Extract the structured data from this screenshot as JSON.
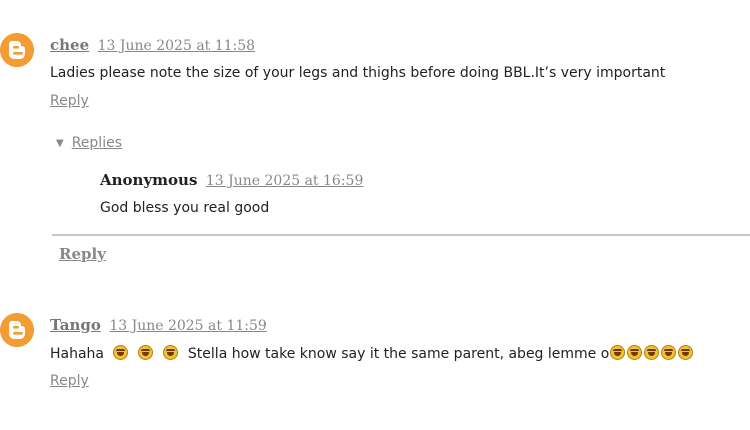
{
  "comments": [
    {
      "author": "chee",
      "timestamp": "13 June 2025 at 11:58",
      "text": "Ladies please note the size of your legs and thighs before doing BBL.It’s very important",
      "reply_label": "Reply",
      "avatar_icon": "blogger-icon",
      "replies_toggle": "Replies",
      "replies": [
        {
          "author": "Anonymous",
          "timestamp": "13 June 2025 at 16:59",
          "text": "God bless you real good"
        }
      ],
      "thread_reply_label": "Reply"
    },
    {
      "author": "Tango",
      "timestamp": "13 June 2025 at 11:59",
      "text_parts": [
        "Hahaha",
        "Stella how take know say it the same parent, abeg lemme o"
      ],
      "emoji": "rolling-on-floor-laughing",
      "reply_label": "Reply",
      "avatar_icon": "blogger-icon"
    }
  ],
  "colors": {
    "avatar": "#f39c33",
    "link_gray": "#888888",
    "divider": "#c7c7c7"
  }
}
